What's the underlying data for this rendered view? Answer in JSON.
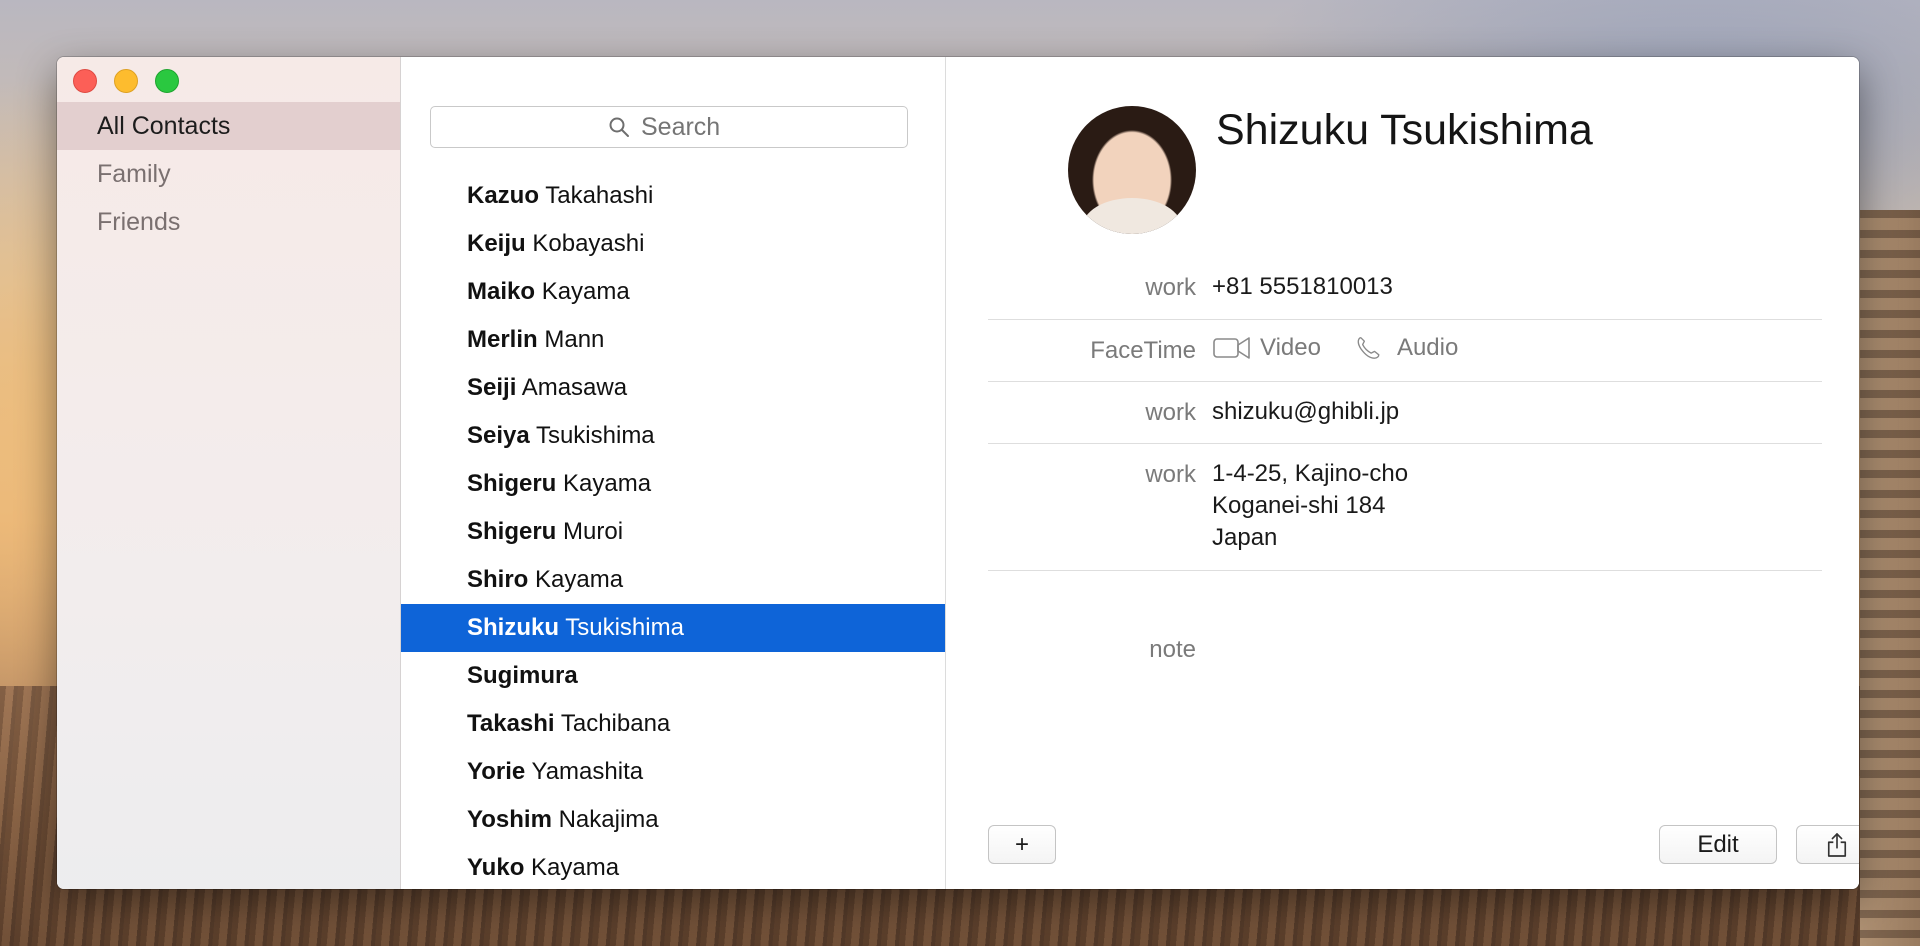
{
  "sidebar": {
    "groups": [
      {
        "label": "All Contacts",
        "selected": true
      },
      {
        "label": "Family"
      },
      {
        "label": "Friends"
      }
    ]
  },
  "search": {
    "placeholder": "Search"
  },
  "contacts": [
    {
      "first": "Kazuo",
      "last": "Takahashi"
    },
    {
      "first": "Keiju",
      "last": "Kobayashi"
    },
    {
      "first": "Maiko",
      "last": "Kayama"
    },
    {
      "first": "Merlin",
      "last": "Mann"
    },
    {
      "first": "Seiji",
      "last": "Amasawa"
    },
    {
      "first": "Seiya",
      "last": "Tsukishima"
    },
    {
      "first": "Shigeru",
      "last": "Kayama"
    },
    {
      "first": "Shigeru",
      "last": "Muroi"
    },
    {
      "first": "Shiro",
      "last": "Kayama"
    },
    {
      "first": "Shizuku",
      "last": "Tsukishima",
      "selected": true
    },
    {
      "first": "Sugimura",
      "last": ""
    },
    {
      "first": "Takashi",
      "last": "Tachibana"
    },
    {
      "first": "Yorie",
      "last": "Yamashita"
    },
    {
      "first": "Yoshim",
      "last": "Nakajima"
    },
    {
      "first": "Yuko",
      "last": "Kayama"
    }
  ],
  "detail": {
    "name": "Shizuku Tsukishima",
    "phone": {
      "label": "work",
      "value": "+81 5551810013"
    },
    "facetime": {
      "label": "FaceTime",
      "video": "Video",
      "audio": "Audio"
    },
    "email": {
      "label": "work",
      "value": "shizuku@ghibli.jp"
    },
    "address": {
      "label": "work",
      "line1": "1-4-25, Kajino-cho",
      "line2": "Koganei-shi 184",
      "line3": "Japan"
    },
    "note": {
      "label": "note"
    }
  },
  "buttons": {
    "add": "+",
    "edit": "Edit",
    "share_icon": "share-icon"
  },
  "colors": {
    "selection": "#0e64d8",
    "sidebar_selection": "#e3cfcf"
  }
}
